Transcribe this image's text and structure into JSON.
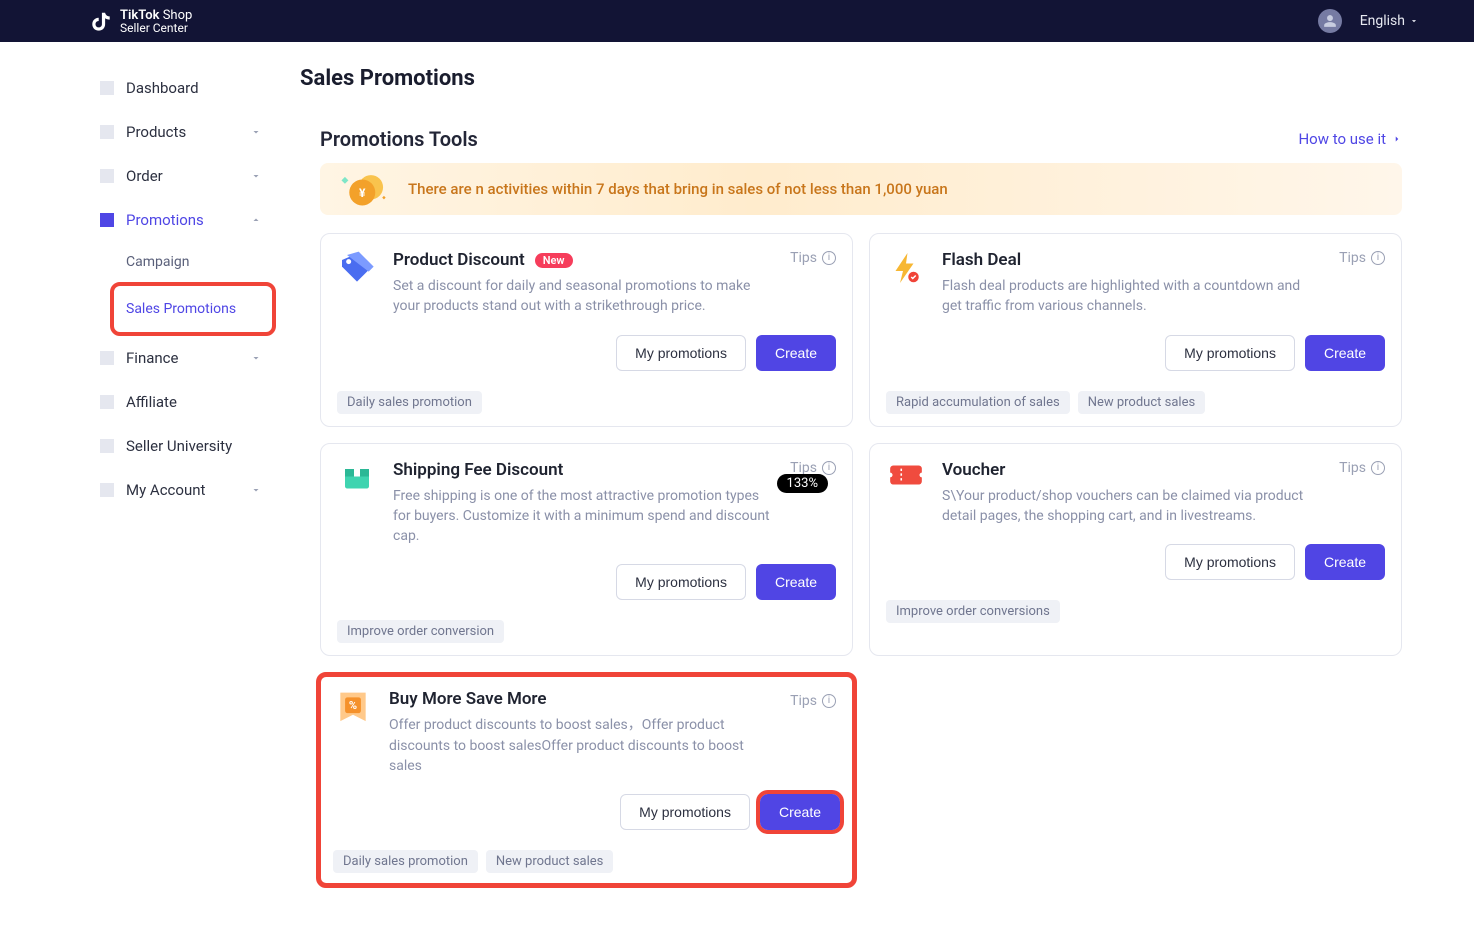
{
  "header": {
    "logo_bold": "TikTok",
    "logo_light": "Shop",
    "logo_sub": "Seller Center",
    "language": "English"
  },
  "sidebar": {
    "items": [
      {
        "label": "Dashboard",
        "expandable": false
      },
      {
        "label": "Products",
        "expandable": true,
        "open": false
      },
      {
        "label": "Order",
        "expandable": true,
        "open": false
      },
      {
        "label": "Promotions",
        "expandable": true,
        "open": true,
        "active": true,
        "children": [
          {
            "label": "Campaign"
          },
          {
            "label": "Sales Promotions",
            "selected": true,
            "highlighted": true
          }
        ]
      },
      {
        "label": "Finance",
        "expandable": true,
        "open": false
      },
      {
        "label": "Affiliate",
        "expandable": false
      },
      {
        "label": "Seller University",
        "expandable": false
      },
      {
        "label": "My Account",
        "expandable": true,
        "open": false
      }
    ]
  },
  "page": {
    "title": "Sales Promotions",
    "section_title": "Promotions Tools",
    "how_to": "How to use it",
    "banner_text": "There are n activities within 7 days that bring in sales of not less than 1,000 yuan",
    "tips_label": "Tips",
    "my_promotions_label": "My promotions",
    "create_label": "Create",
    "new_badge": "New",
    "zoom": "133%"
  },
  "cards": [
    {
      "title": "Product Discount",
      "new": true,
      "desc": "Set a discount for daily and seasonal promotions to make your products stand out with a strikethrough price.",
      "tags": [
        "Daily sales promotion"
      ],
      "icon": "tags-icon",
      "highlighted": false
    },
    {
      "title": "Flash Deal",
      "new": false,
      "desc": "Flash deal products are highlighted with a countdown and get traffic from various channels.",
      "tags": [
        "Rapid accumulation of sales",
        "New product sales"
      ],
      "icon": "bolt-icon",
      "highlighted": false
    },
    {
      "title": "Shipping Fee Discount",
      "new": false,
      "desc": "Free shipping is one of the most attractive promotion types for buyers. Customize it with a minimum spend and discount cap.",
      "tags": [
        "Improve order conversion"
      ],
      "icon": "box-icon",
      "highlighted": false
    },
    {
      "title": "Voucher",
      "new": false,
      "desc": "S\\Your product/shop vouchers can be claimed via product detail pages, the shopping cart, and in livestreams.",
      "tags": [
        "Improve order conversions"
      ],
      "icon": "ticket-icon",
      "highlighted": false
    },
    {
      "title": "Buy More Save More",
      "new": false,
      "desc": "Offer product discounts to boost sales，Offer product discounts to boost salesOffer product discounts to boost sales",
      "tags": [
        "Daily sales promotion",
        "New product sales"
      ],
      "icon": "percent-icon",
      "highlighted": true
    }
  ]
}
